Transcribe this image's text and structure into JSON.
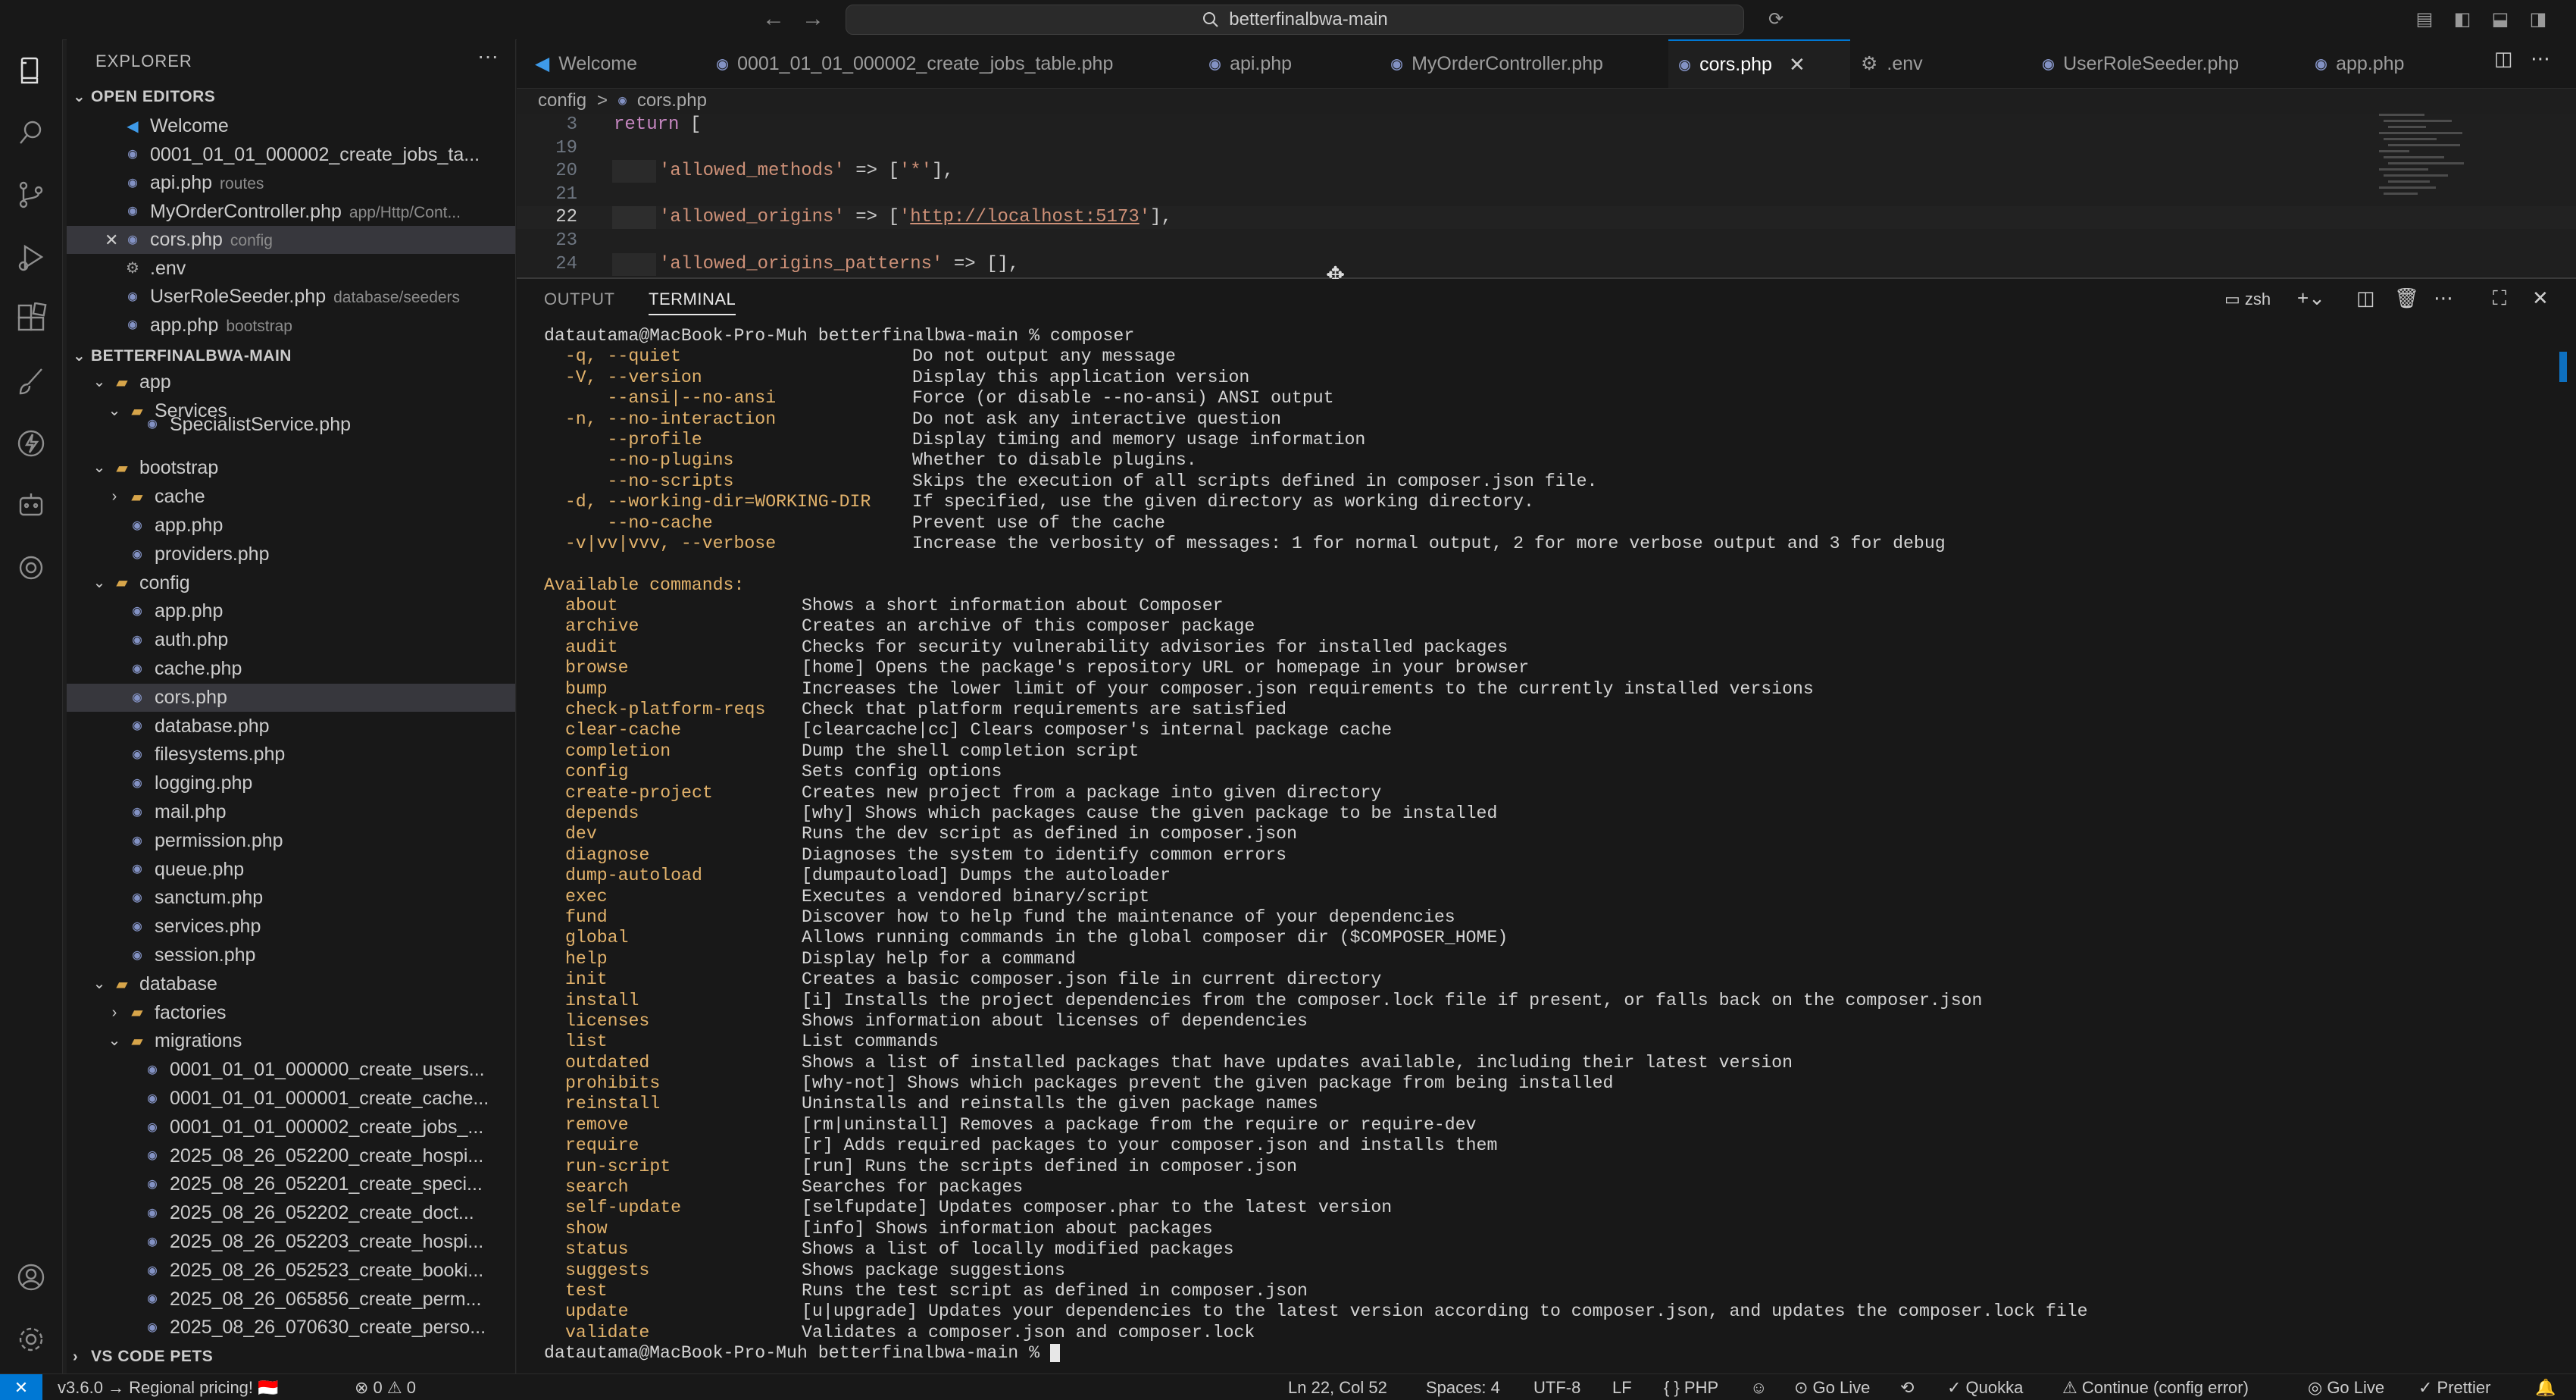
{
  "titlebar": {
    "search_text": "betterfinalbwa-main",
    "back": "←",
    "forward": "→"
  },
  "sidebar": {
    "title": "EXPLORER",
    "more": "···",
    "open_editors": {
      "header": "OPEN EDITORS",
      "items": [
        {
          "name": "Welcome",
          "desc": "",
          "icon": "vscode"
        },
        {
          "name": "0001_01_01_000002_create_jobs_ta...",
          "desc": "",
          "icon": "php"
        },
        {
          "name": "api.php",
          "desc": "routes",
          "icon": "php"
        },
        {
          "name": "MyOrderController.php",
          "desc": "app/Http/Cont...",
          "icon": "php"
        },
        {
          "name": "cors.php",
          "desc": "config",
          "icon": "php"
        },
        {
          "name": ".env",
          "desc": "",
          "icon": "gear"
        },
        {
          "name": "UserRoleSeeder.php",
          "desc": "database/seeders",
          "icon": "php"
        },
        {
          "name": "app.php",
          "desc": "bootstrap",
          "icon": "php"
        }
      ]
    },
    "project": {
      "header": "BETTERFINALBWA-MAIN",
      "tree": [
        {
          "name": "app",
          "type": "folder",
          "open": true,
          "depth": 1
        },
        {
          "name": "Services",
          "type": "folder",
          "open": true,
          "depth": 2
        },
        {
          "name": "SpecialistService.php",
          "type": "php",
          "depth": 3
        },
        {
          "name": "bootstrap",
          "type": "folder",
          "open": true,
          "depth": 1
        },
        {
          "name": "cache",
          "type": "folder",
          "open": false,
          "depth": 2
        },
        {
          "name": "app.php",
          "type": "php",
          "depth": 2
        },
        {
          "name": "providers.php",
          "type": "php",
          "depth": 2
        },
        {
          "name": "config",
          "type": "folder",
          "open": true,
          "depth": 1
        },
        {
          "name": "app.php",
          "type": "php",
          "depth": 2
        },
        {
          "name": "auth.php",
          "type": "php",
          "depth": 2
        },
        {
          "name": "cache.php",
          "type": "php",
          "depth": 2
        },
        {
          "name": "cors.php",
          "type": "php",
          "depth": 2,
          "selected": true
        },
        {
          "name": "database.php",
          "type": "php",
          "depth": 2
        },
        {
          "name": "filesystems.php",
          "type": "php",
          "depth": 2
        },
        {
          "name": "logging.php",
          "type": "php",
          "depth": 2
        },
        {
          "name": "mail.php",
          "type": "php",
          "depth": 2
        },
        {
          "name": "permission.php",
          "type": "php",
          "depth": 2
        },
        {
          "name": "queue.php",
          "type": "php",
          "depth": 2
        },
        {
          "name": "sanctum.php",
          "type": "php",
          "depth": 2
        },
        {
          "name": "services.php",
          "type": "php",
          "depth": 2
        },
        {
          "name": "session.php",
          "type": "php",
          "depth": 2
        },
        {
          "name": "database",
          "type": "folder",
          "open": true,
          "depth": 1
        },
        {
          "name": "factories",
          "type": "folder",
          "open": false,
          "depth": 2
        },
        {
          "name": "migrations",
          "type": "folder",
          "open": true,
          "depth": 2
        },
        {
          "name": "0001_01_01_000000_create_users...",
          "type": "php",
          "depth": 3
        },
        {
          "name": "0001_01_01_000001_create_cache...",
          "type": "php",
          "depth": 3
        },
        {
          "name": "0001_01_01_000002_create_jobs_...",
          "type": "php",
          "depth": 3
        },
        {
          "name": "2025_08_26_052200_create_hospi...",
          "type": "php",
          "depth": 3
        },
        {
          "name": "2025_08_26_052201_create_speci...",
          "type": "php",
          "depth": 3
        },
        {
          "name": "2025_08_26_052202_create_doct...",
          "type": "php",
          "depth": 3
        },
        {
          "name": "2025_08_26_052203_create_hospi...",
          "type": "php",
          "depth": 3
        },
        {
          "name": "2025_08_26_052523_create_booki...",
          "type": "php",
          "depth": 3
        },
        {
          "name": "2025_08_26_065856_create_perm...",
          "type": "php",
          "depth": 3
        },
        {
          "name": "2025_08_26_070630_create_perso...",
          "type": "php",
          "depth": 3
        }
      ]
    },
    "pets_header": "VS CODE PETS"
  },
  "tabs": [
    {
      "label": "Welcome",
      "icon": "vscode"
    },
    {
      "label": "0001_01_01_000002_create_jobs_table.php",
      "icon": "php"
    },
    {
      "label": "api.php",
      "icon": "php"
    },
    {
      "label": "MyOrderController.php",
      "icon": "php"
    },
    {
      "label": "cors.php",
      "icon": "php",
      "active": true
    },
    {
      "label": ".env",
      "icon": "gear"
    },
    {
      "label": "UserRoleSeeder.php",
      "icon": "php"
    },
    {
      "label": "app.php",
      "icon": "php"
    }
  ],
  "breadcrumb": {
    "folder": "config",
    "sep": ">",
    "file": "cors.php"
  },
  "code": [
    {
      "ln": "3",
      "text": "return [",
      "kind": "return"
    },
    {
      "ln": "19",
      "text": "",
      "kind": "blank"
    },
    {
      "ln": "20",
      "pre": "'allowed_methods' => [",
      "str": "'*'",
      "post": "],",
      "kind": "kv"
    },
    {
      "ln": "21",
      "text": "",
      "kind": "blank"
    },
    {
      "ln": "22",
      "pre": "'allowed_origins' => ['",
      "link": "http://localhost:5173",
      "post": "'],",
      "kind": "link",
      "current": true
    },
    {
      "ln": "23",
      "text": "",
      "kind": "blank"
    },
    {
      "ln": "24",
      "pre": "'allowed_origins_patterns' => [],",
      "kind": "kv2"
    }
  ],
  "panel": {
    "tabs": [
      "OUTPUT",
      "TERMINAL"
    ],
    "active_tab": "TERMINAL",
    "shell": "zsh",
    "prompt": "datautama@MacBook-Pro-Muh betterfinalbwa-main % ",
    "command": "composer",
    "options": [
      {
        "flag": "  -q, --quiet",
        "desc": "Do not output any message"
      },
      {
        "flag": "  -V, --version",
        "desc": "Display this application version"
      },
      {
        "flag": "      --ansi|--no-ansi",
        "desc": "Force (or disable --no-ansi) ANSI output"
      },
      {
        "flag": "  -n, --no-interaction",
        "desc": "Do not ask any interactive question"
      },
      {
        "flag": "      --profile",
        "desc": "Display timing and memory usage information"
      },
      {
        "flag": "      --no-plugins",
        "desc": "Whether to disable plugins."
      },
      {
        "flag": "      --no-scripts",
        "desc": "Skips the execution of all scripts defined in composer.json file."
      },
      {
        "flag": "  -d, --working-dir=WORKING-DIR",
        "desc": "If specified, use the given directory as working directory."
      },
      {
        "flag": "      --no-cache",
        "desc": "Prevent use of the cache"
      },
      {
        "flag": "  -v|vv|vvv, --verbose",
        "desc": "Increase the verbosity of messages: 1 for normal output, 2 for more verbose output and 3 for debug"
      }
    ],
    "available_header": "Available commands:",
    "commands": [
      {
        "name": "about",
        "desc": "Shows a short information about Composer"
      },
      {
        "name": "archive",
        "desc": "Creates an archive of this composer package"
      },
      {
        "name": "audit",
        "desc": "Checks for security vulnerability advisories for installed packages"
      },
      {
        "name": "browse",
        "desc": "[home] Opens the package's repository URL or homepage in your browser"
      },
      {
        "name": "bump",
        "desc": "Increases the lower limit of your composer.json requirements to the currently installed versions"
      },
      {
        "name": "check-platform-reqs",
        "desc": "Check that platform requirements are satisfied"
      },
      {
        "name": "clear-cache",
        "desc": "[clearcache|cc] Clears composer's internal package cache"
      },
      {
        "name": "completion",
        "desc": "Dump the shell completion script"
      },
      {
        "name": "config",
        "desc": "Sets config options"
      },
      {
        "name": "create-project",
        "desc": "Creates new project from a package into given directory"
      },
      {
        "name": "depends",
        "desc": "[why] Shows which packages cause the given package to be installed"
      },
      {
        "name": "dev",
        "desc": "Runs the dev script as defined in composer.json"
      },
      {
        "name": "diagnose",
        "desc": "Diagnoses the system to identify common errors"
      },
      {
        "name": "dump-autoload",
        "desc": "[dumpautoload] Dumps the autoloader"
      },
      {
        "name": "exec",
        "desc": "Executes a vendored binary/script"
      },
      {
        "name": "fund",
        "desc": "Discover how to help fund the maintenance of your dependencies"
      },
      {
        "name": "global",
        "desc": "Allows running commands in the global composer dir ($COMPOSER_HOME)"
      },
      {
        "name": "help",
        "desc": "Display help for a command"
      },
      {
        "name": "init",
        "desc": "Creates a basic composer.json file in current directory"
      },
      {
        "name": "install",
        "desc": "[i] Installs the project dependencies from the composer.lock file if present, or falls back on the composer.json"
      },
      {
        "name": "licenses",
        "desc": "Shows information about licenses of dependencies"
      },
      {
        "name": "list",
        "desc": "List commands"
      },
      {
        "name": "outdated",
        "desc": "Shows a list of installed packages that have updates available, including their latest version"
      },
      {
        "name": "prohibits",
        "desc": "[why-not] Shows which packages prevent the given package from being installed"
      },
      {
        "name": "reinstall",
        "desc": "Uninstalls and reinstalls the given package names"
      },
      {
        "name": "remove",
        "desc": "[rm|uninstall] Removes a package from the require or require-dev"
      },
      {
        "name": "require",
        "desc": "[r] Adds required packages to your composer.json and installs them"
      },
      {
        "name": "run-script",
        "desc": "[run] Runs the scripts defined in composer.json"
      },
      {
        "name": "search",
        "desc": "Searches for packages"
      },
      {
        "name": "self-update",
        "desc": "[selfupdate] Updates composer.phar to the latest version"
      },
      {
        "name": "show",
        "desc": "[info] Shows information about packages"
      },
      {
        "name": "status",
        "desc": "Shows a list of locally modified packages"
      },
      {
        "name": "suggests",
        "desc": "Shows package suggestions"
      },
      {
        "name": "test",
        "desc": "Runs the test script as defined in composer.json"
      },
      {
        "name": "update",
        "desc": "[u|upgrade] Updates your dependencies to the latest version according to composer.json, and updates the composer.lock file"
      },
      {
        "name": "validate",
        "desc": "Validates a composer.json and composer.lock"
      }
    ],
    "final_prompt": "datautama@MacBook-Pro-Muh betterfinalbwa-main % "
  },
  "statusbar": {
    "remote": "✕",
    "version": "v3.6.0 → Regional pricing! 🇮🇩",
    "errors": "⊗ 0 ⚠ 0",
    "position": "Ln 22, Col 52",
    "spaces": "Spaces: 4",
    "encoding": "UTF-8",
    "eol": "LF",
    "language": "{ } PHP",
    "golive1": "Go Live",
    "quokka": "Quokka",
    "continue": "⚠ Continue (config error)",
    "golive2": "Go Live",
    "prettier": "Prettier"
  },
  "colors": {
    "accent": "#0078d4",
    "php": "#8392c4",
    "folder": "#d7a54a",
    "terminal_yellow": "#e2b26b"
  }
}
